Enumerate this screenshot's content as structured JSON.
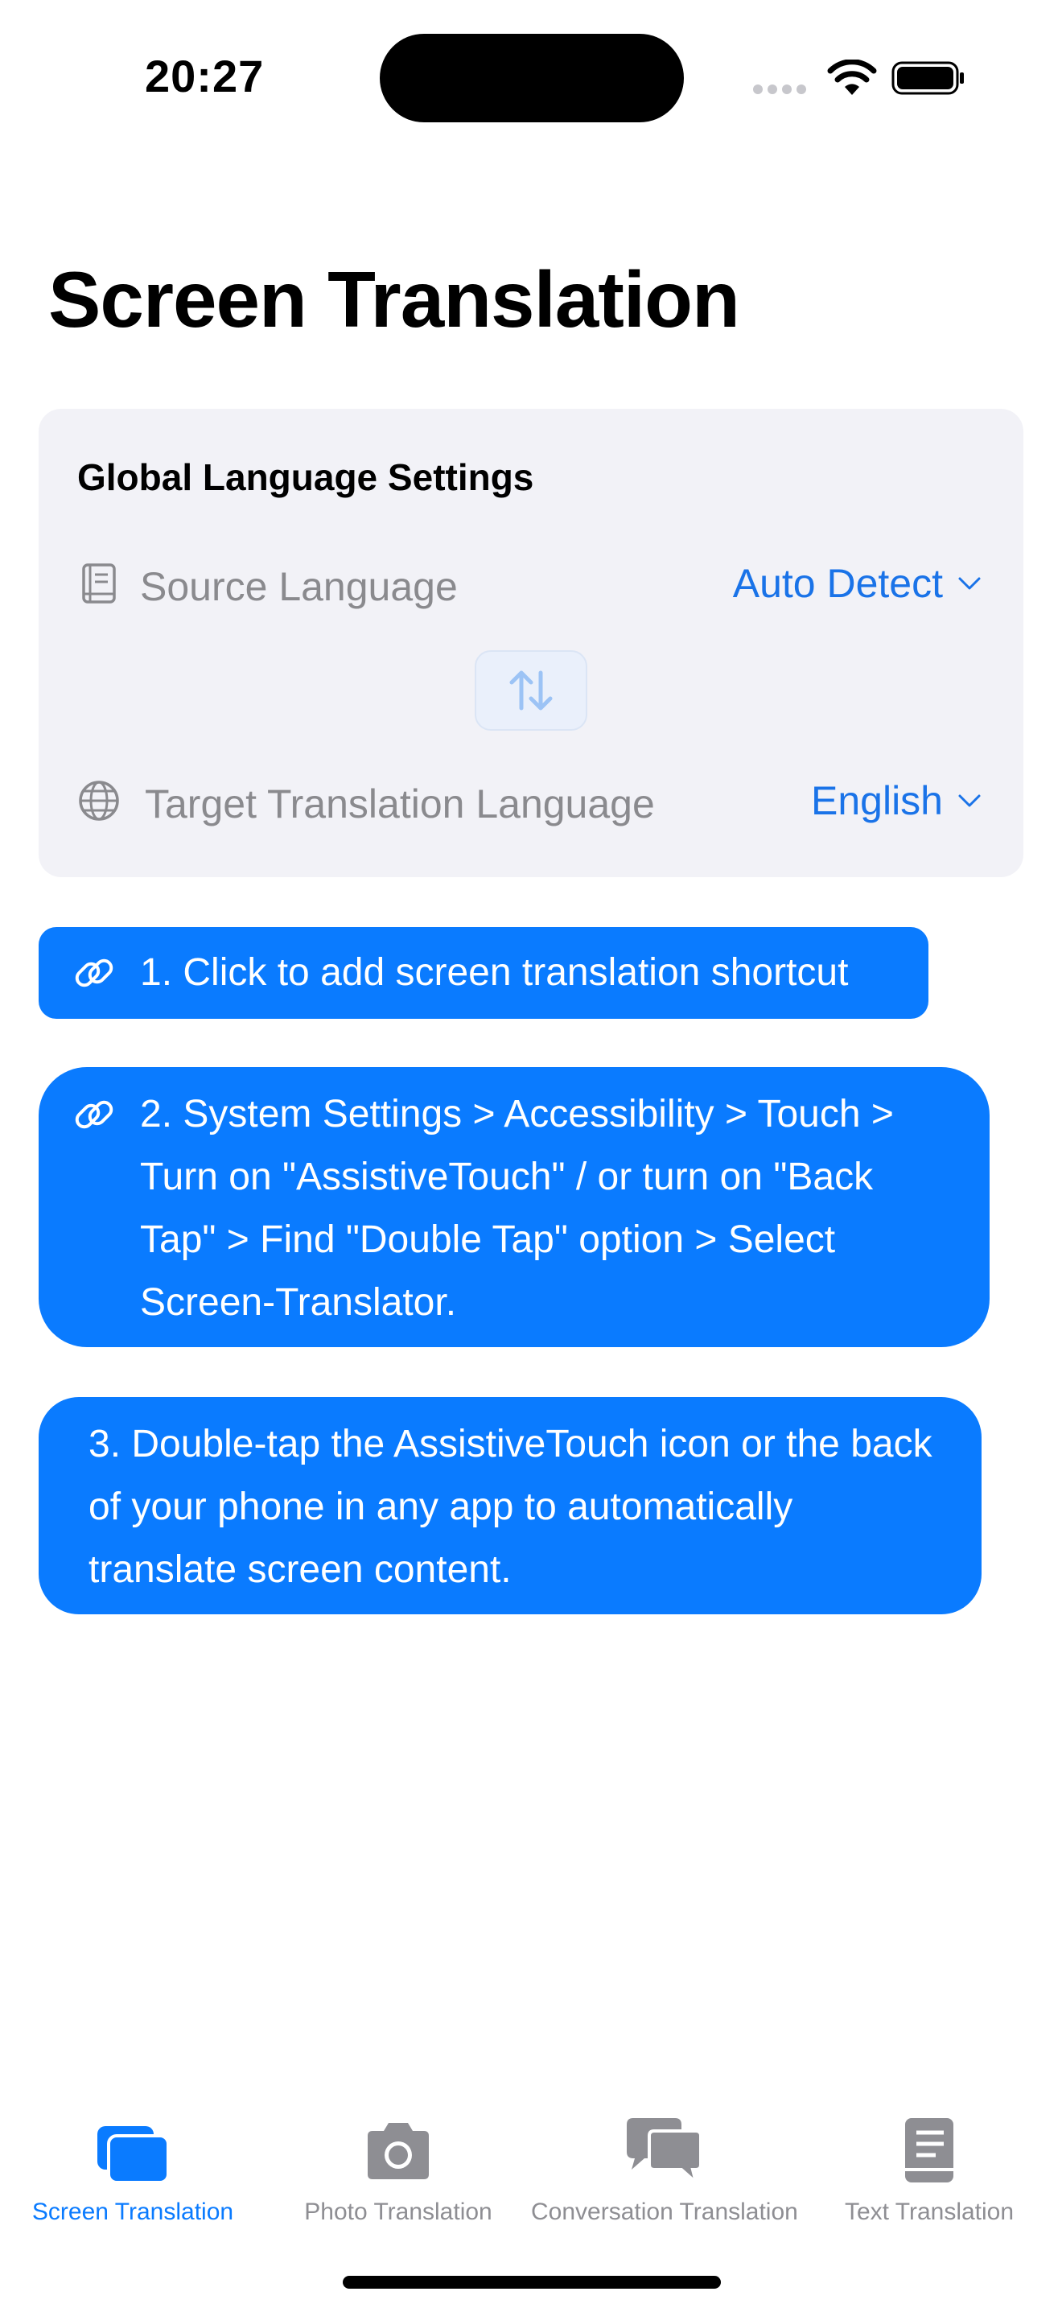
{
  "status_bar": {
    "time": "20:27"
  },
  "page": {
    "title": "Screen Translation"
  },
  "settings": {
    "heading": "Global Language Settings",
    "source": {
      "label": "Source Language",
      "value": "Auto Detect",
      "icon": "book-icon"
    },
    "target": {
      "label": "Target Translation Language",
      "value": "English",
      "icon": "globe-icon"
    },
    "swap_icon": "swap-arrows-icon"
  },
  "steps": [
    {
      "text": "1. Click to add screen translation shortcut",
      "icon": "link-icon"
    },
    {
      "text": "2. System Settings > Accessibility > Touch > Turn on \"AssistiveTouch\" / or turn on \"Back Tap\" > Find \"Double Tap\" option > Select Screen-Translator.",
      "icon": "link-icon"
    },
    {
      "text": "3. Double-tap the AssistiveTouch icon or the back of your phone in any app to automatically translate screen content."
    }
  ],
  "tabs": [
    {
      "label": "Screen Translation",
      "icon": "screens-icon",
      "active": true
    },
    {
      "label": "Photo Translation",
      "icon": "camera-icon",
      "active": false
    },
    {
      "label": "Conversation Translation",
      "icon": "chat-bubbles-icon",
      "active": false
    },
    {
      "label": "Text Translation",
      "icon": "document-book-icon",
      "active": false
    }
  ],
  "colors": {
    "accent": "#0a7bff",
    "link_text": "#1a73e8",
    "secondary_text": "#8a8a8e",
    "card_bg": "#f2f2f7",
    "tab_inactive": "#8e8e93"
  }
}
